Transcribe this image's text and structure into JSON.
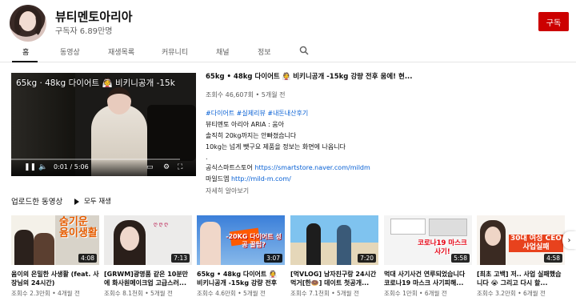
{
  "channel": {
    "name": "뷰티멘토아리아",
    "subscribers": "구독자 6.89만명",
    "subscribe_label": "구독"
  },
  "tabs": [
    "홈",
    "동영상",
    "재생목록",
    "커뮤니티",
    "채널",
    "정보"
  ],
  "featured": {
    "overlay_title": "65kg · 48kg 다이어트 👰 비키니공개 -15k",
    "title": "65kg • 48kg 다이어트 👰 비키니공개 -15kg 강량 전후 움에! 현...",
    "views": "조회수 46,607회",
    "age": "5개월 전",
    "tags": "#다이어트 #실제리뷰 #내돈내산후기",
    "desc_lines": [
      "뷰티멘토 아리아 ARIA : 움아",
      "솔직히 20kg까지는 안빠졌습니다",
      "10kg는 넘게 뺏구요 제품을 정보는 화면에 나옵니다",
      ".",
      "공식스마트스토어 https://smartstore.naver.com/mildm",
      "마일드엠 http://mild-m.com/"
    ],
    "link1_prefix": "공식스마트스토어 ",
    "link1": "https://smartstore.naver.com/mildm",
    "link2_prefix": "마일드엠 ",
    "link2": "http://mild-m.com/",
    "more": "자세히 알아보기",
    "time": "0:01 / 5:06"
  },
  "uploads": {
    "heading": "업로드한 동영상",
    "play_all": "모두 재생",
    "videos": [
      {
        "title": "윰이의 은밀한 사생활 (feat. 사장님의 24시간)",
        "views": "조회수 2.3만회",
        "age": "4개월 전",
        "duration": "4:08",
        "thumb_text": "숨기운 윰이생활"
      },
      {
        "title": "[GRWM]광명품 같은 10분만에 화사원메이크업 고급스러...",
        "views": "조회수 8.1천회",
        "age": "5개월 전",
        "duration": "7:13",
        "thumb_text": ""
      },
      {
        "title": "65kg • 48kg 다이어트 👰 비키니공개 -15kg 강량 전후 움...",
        "views": "조회수 4.6만회",
        "age": "5개월 전",
        "duration": "3:07",
        "thumb_text": "-20KG 다이어트 성공 꿀팁?"
      },
      {
        "title": "[먹VLOG] 남자친구랑 24시간 먹거[한🍩] 데이트 첫공개...",
        "views": "조회수 7.1천회",
        "age": "5개월 전",
        "duration": "7:20",
        "thumb_text": ""
      },
      {
        "title": "먹대 사기사건 연루되었습니다 코로나19 마스크 사기피해...",
        "views": "조회수 1만회",
        "age": "6개월 전",
        "duration": "5:58",
        "thumb_text": "코로나19 마스크 사기!"
      },
      {
        "title": "[최초 고백] 저.. 사업 실패했습니다 😭 그리고 다시 할...",
        "views": "조회수 3.2만회",
        "age": "6개월 전",
        "duration": "4:58",
        "thumb_text": "30대 여성 CEO 사업실패"
      }
    ]
  },
  "colors": {
    "accent_red": "#cc0000",
    "link_blue": "#065fd4",
    "muted": "#606060"
  }
}
